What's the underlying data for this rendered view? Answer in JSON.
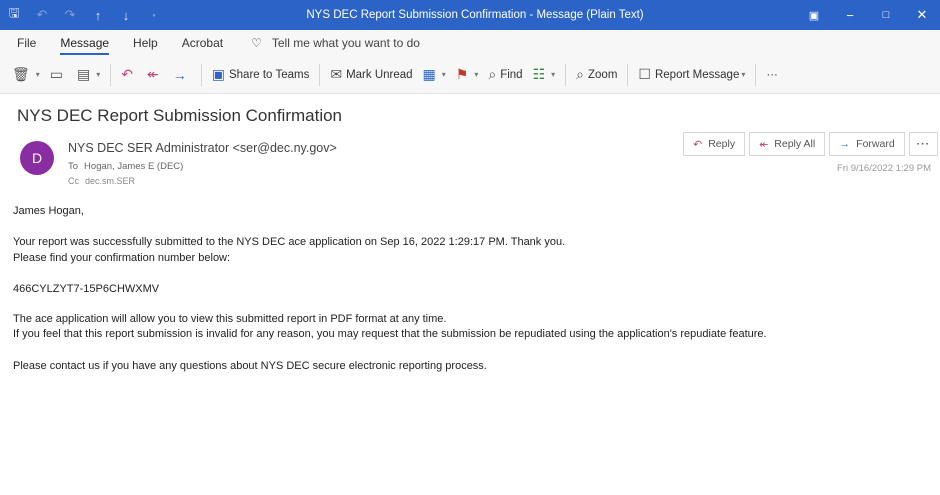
{
  "window": {
    "title": "NYS DEC Report Submission Confirmation  -  Message (Plain Text)"
  },
  "menu": {
    "items": [
      "File",
      "Message",
      "Help",
      "Acrobat"
    ],
    "active": "Message",
    "tell_me": "Tell me what you want to do"
  },
  "ribbon": {
    "share_to_teams": "Share to Teams",
    "mark_unread": "Mark Unread",
    "find": "Find",
    "zoom": "Zoom",
    "report_message": "Report Message",
    "more": "···"
  },
  "message": {
    "subject": "NYS DEC Report Submission Confirmation",
    "avatar_initial": "D",
    "sender": "NYS DEC SER Administrator <ser@dec.ny.gov>",
    "to_label": "To",
    "to": "Hogan, James E (DEC)",
    "cc_label": "Cc",
    "cc": "dec.sm.SER",
    "datetime": "Fri 9/16/2022 1:29 PM",
    "actions": {
      "reply": "Reply",
      "reply_all": "Reply All",
      "forward": "Forward",
      "more": "···"
    },
    "body": {
      "greeting": "James Hogan,",
      "line1": "Your report was successfully submitted to the NYS DEC ace application on Sep 16, 2022 1:29:17 PM. Thank you.",
      "line2": "Please find your confirmation number below:",
      "confirmation_number": "466CYLZYT7-15P6CHWXMV",
      "line3": "The ace application will allow you to view this submitted report in PDF format at any time.",
      "line4": "If you feel that this report submission is invalid for any reason, you may request that the submission be repudiated using the application's repudiate feature.",
      "line5": "Please contact us if you have any questions about NYS DEC secure electronic reporting process."
    }
  }
}
